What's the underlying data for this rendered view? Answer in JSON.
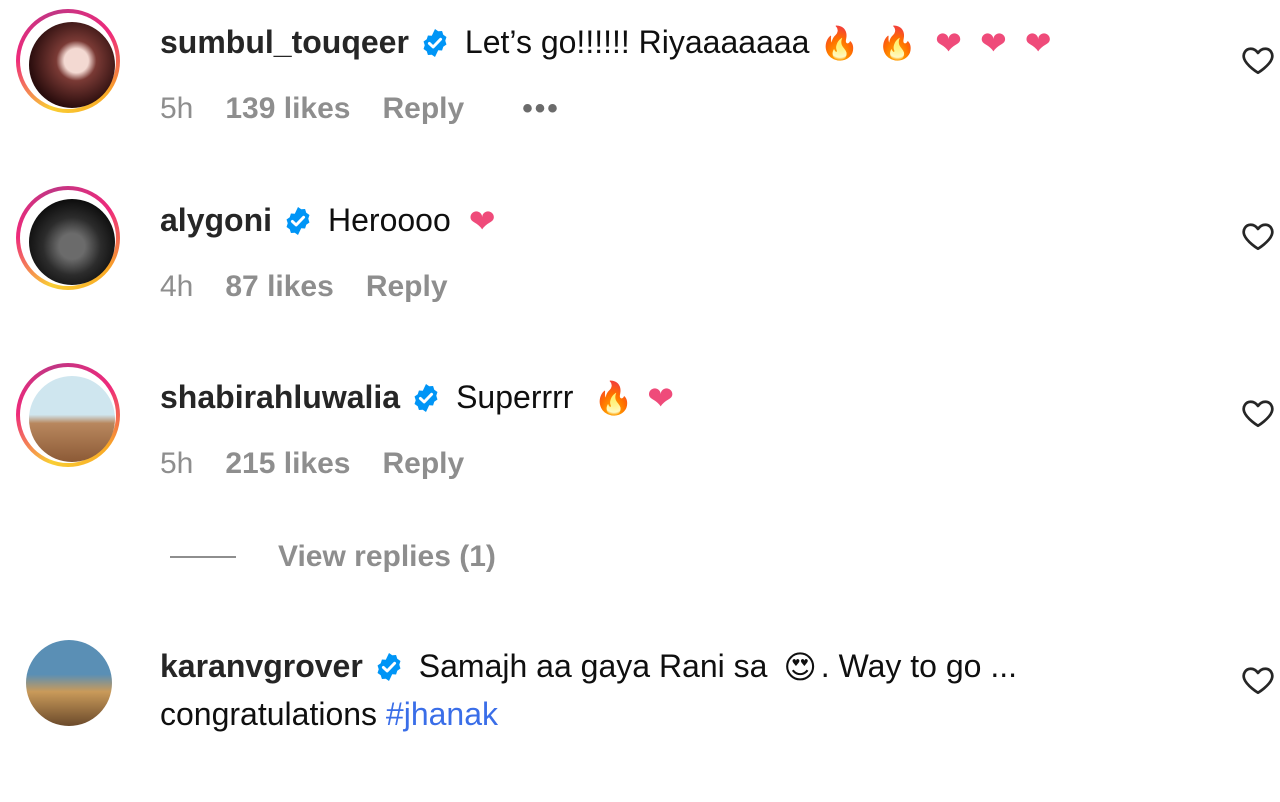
{
  "comments": [
    {
      "username": "sumbul_touqeer",
      "text": "Let’s go!!!!!! Riyaaaaaaa",
      "emojis": [
        "🔥",
        "🔥",
        "❤",
        "❤",
        "❤"
      ],
      "time": "5h",
      "likes": "139 likes",
      "reply": "Reply",
      "more": "•••"
    },
    {
      "username": "alygoni",
      "text": "Heroooo",
      "emojis": [
        "❤"
      ],
      "time": "4h",
      "likes": "87 likes",
      "reply": "Reply"
    },
    {
      "username": "shabirahluwalia",
      "text": "Superrrr",
      "emojis": [
        "🔥",
        "❤"
      ],
      "time": "5h",
      "likes": "215 likes",
      "reply": "Reply"
    },
    {
      "username": "karanvgrover",
      "text": "Samajh aa gaya Rani sa",
      "emoji": "😍",
      "text_after": ". Way to go ...",
      "second_line": "congratulations",
      "hashtag": "#jhanak"
    }
  ],
  "view_replies": "View replies (1)",
  "colors": {
    "username": "#262626",
    "meta": "#8e8e8e",
    "verified": "#0095f6",
    "hashtag": "#3a6ee8",
    "heart": "#ef4b7a",
    "fire": "#ff7a1a"
  },
  "icons": {
    "verified": "verified-badge-icon",
    "like": "heart-outline-icon"
  }
}
